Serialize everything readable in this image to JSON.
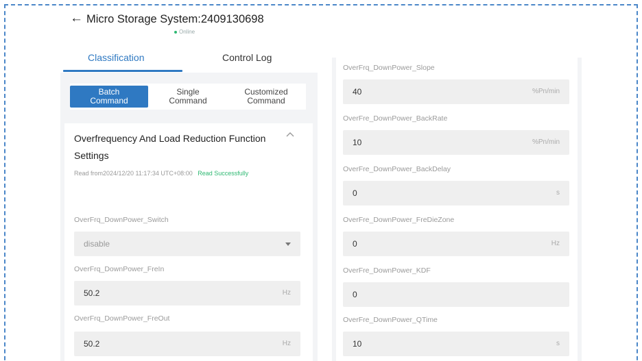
{
  "header": {
    "title": "Micro Storage System:2409130698",
    "status": "Online"
  },
  "tabs": [
    {
      "label": "Classification",
      "active": true
    },
    {
      "label": "Control Log",
      "active": false
    }
  ],
  "command_types": {
    "batch": "Batch Command",
    "single": "Single Command",
    "custom": "Customized Command"
  },
  "settings": {
    "title": "Overfrequency And Load Reduction Function Settings",
    "read_info": "Read from2024/12/20 11:17:34 UTC+08:00",
    "read_status": "Read Successfully"
  },
  "left_fields": [
    {
      "label": "OverFrq_DownPower_Switch",
      "value": "disable",
      "unit": ""
    },
    {
      "label": "OverFrq_DownPower_FreIn",
      "value": "50.2",
      "unit": "Hz"
    },
    {
      "label": "OverFrq_DownPower_FreOut",
      "value": "50.2",
      "unit": "Hz"
    }
  ],
  "right_fields": [
    {
      "label": "OverFrq_DownPower_Slope",
      "value": "40",
      "unit": "%Pn/min"
    },
    {
      "label": "OverFre_DownPower_BackRate",
      "value": "10",
      "unit": "%Pn/min"
    },
    {
      "label": "OverFre_DownPower_BackDelay",
      "value": "0",
      "unit": "s"
    },
    {
      "label": "OverFre_DownPower_FreDieZone",
      "value": "0",
      "unit": "Hz"
    },
    {
      "label": "OverFre_DownPower_KDF",
      "value": "0",
      "unit": ""
    },
    {
      "label": "OverFre_DownPower_QTime",
      "value": "10",
      "unit": "s"
    }
  ],
  "colors": {
    "accent": "#2f79c2",
    "success": "#2eb872",
    "frame": "#4a86c8"
  }
}
